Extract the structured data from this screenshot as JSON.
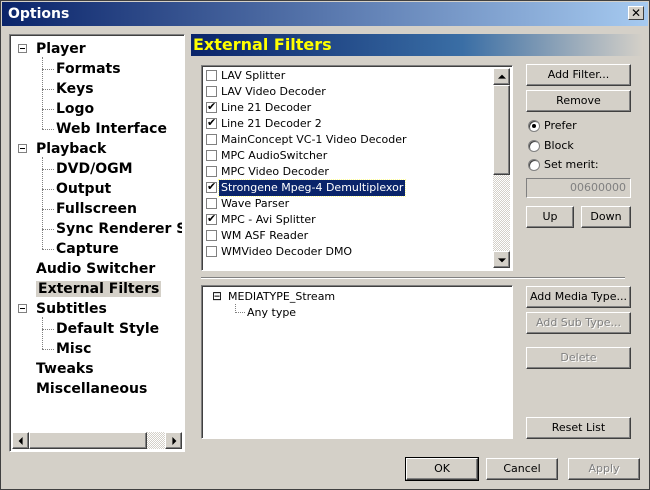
{
  "window": {
    "title": "Options",
    "close": "✕"
  },
  "tree": {
    "items": [
      {
        "label": "Player",
        "level": 0,
        "expander": true
      },
      {
        "label": "Formats",
        "level": 1
      },
      {
        "label": "Keys",
        "level": 1
      },
      {
        "label": "Logo",
        "level": 1
      },
      {
        "label": "Web Interface",
        "level": 1
      },
      {
        "label": "Playback",
        "level": 0,
        "expander": true
      },
      {
        "label": "DVD/OGM",
        "level": 1
      },
      {
        "label": "Output",
        "level": 1
      },
      {
        "label": "Fullscreen",
        "level": 1
      },
      {
        "label": "Sync Renderer Se",
        "level": 1
      },
      {
        "label": "Capture",
        "level": 1
      },
      {
        "label": "Audio Switcher",
        "level": 0
      },
      {
        "label": "External Filters",
        "level": 0,
        "selected": true
      },
      {
        "label": "Subtitles",
        "level": 0,
        "expander": true
      },
      {
        "label": "Default Style",
        "level": 1
      },
      {
        "label": "Misc",
        "level": 1
      },
      {
        "label": "Tweaks",
        "level": 0
      },
      {
        "label": "Miscellaneous",
        "level": 0
      }
    ]
  },
  "page": {
    "title": "External Filters"
  },
  "filters": [
    {
      "label": "LAV Splitter",
      "checked": false
    },
    {
      "label": "LAV Video Decoder",
      "checked": false
    },
    {
      "label": "Line 21 Decoder",
      "checked": true
    },
    {
      "label": "Line 21 Decoder 2",
      "checked": true
    },
    {
      "label": "MainConcept VC-1 Video Decoder",
      "checked": false
    },
    {
      "label": "MPC AudioSwitcher",
      "checked": false
    },
    {
      "label": "MPC Video Decoder",
      "checked": false
    },
    {
      "label": "Strongene Mpeg-4 Demultiplexor",
      "checked": true,
      "selected": true
    },
    {
      "label": "Wave Parser",
      "checked": false
    },
    {
      "label": "MPC - Avi Splitter",
      "checked": true
    },
    {
      "label": "WM ASF Reader",
      "checked": false
    },
    {
      "label": "WMVideo Decoder DMO",
      "checked": false
    }
  ],
  "media": {
    "type": "MEDIATYPE_Stream",
    "subtype": "Any type",
    "expander": "⊟"
  },
  "buttons": {
    "add_filter": "Add Filter...",
    "remove": "Remove",
    "up": "Up",
    "down": "Down",
    "add_media_type": "Add Media Type...",
    "add_sub_type": "Add Sub Type...",
    "delete": "Delete",
    "reset_list": "Reset List",
    "ok": "OK",
    "cancel": "Cancel",
    "apply": "Apply"
  },
  "merit": {
    "prefer": "Prefer",
    "block": "Block",
    "set_merit": "Set merit:",
    "value": "00600000",
    "selected": "prefer"
  },
  "icons": {
    "check": "✔"
  }
}
